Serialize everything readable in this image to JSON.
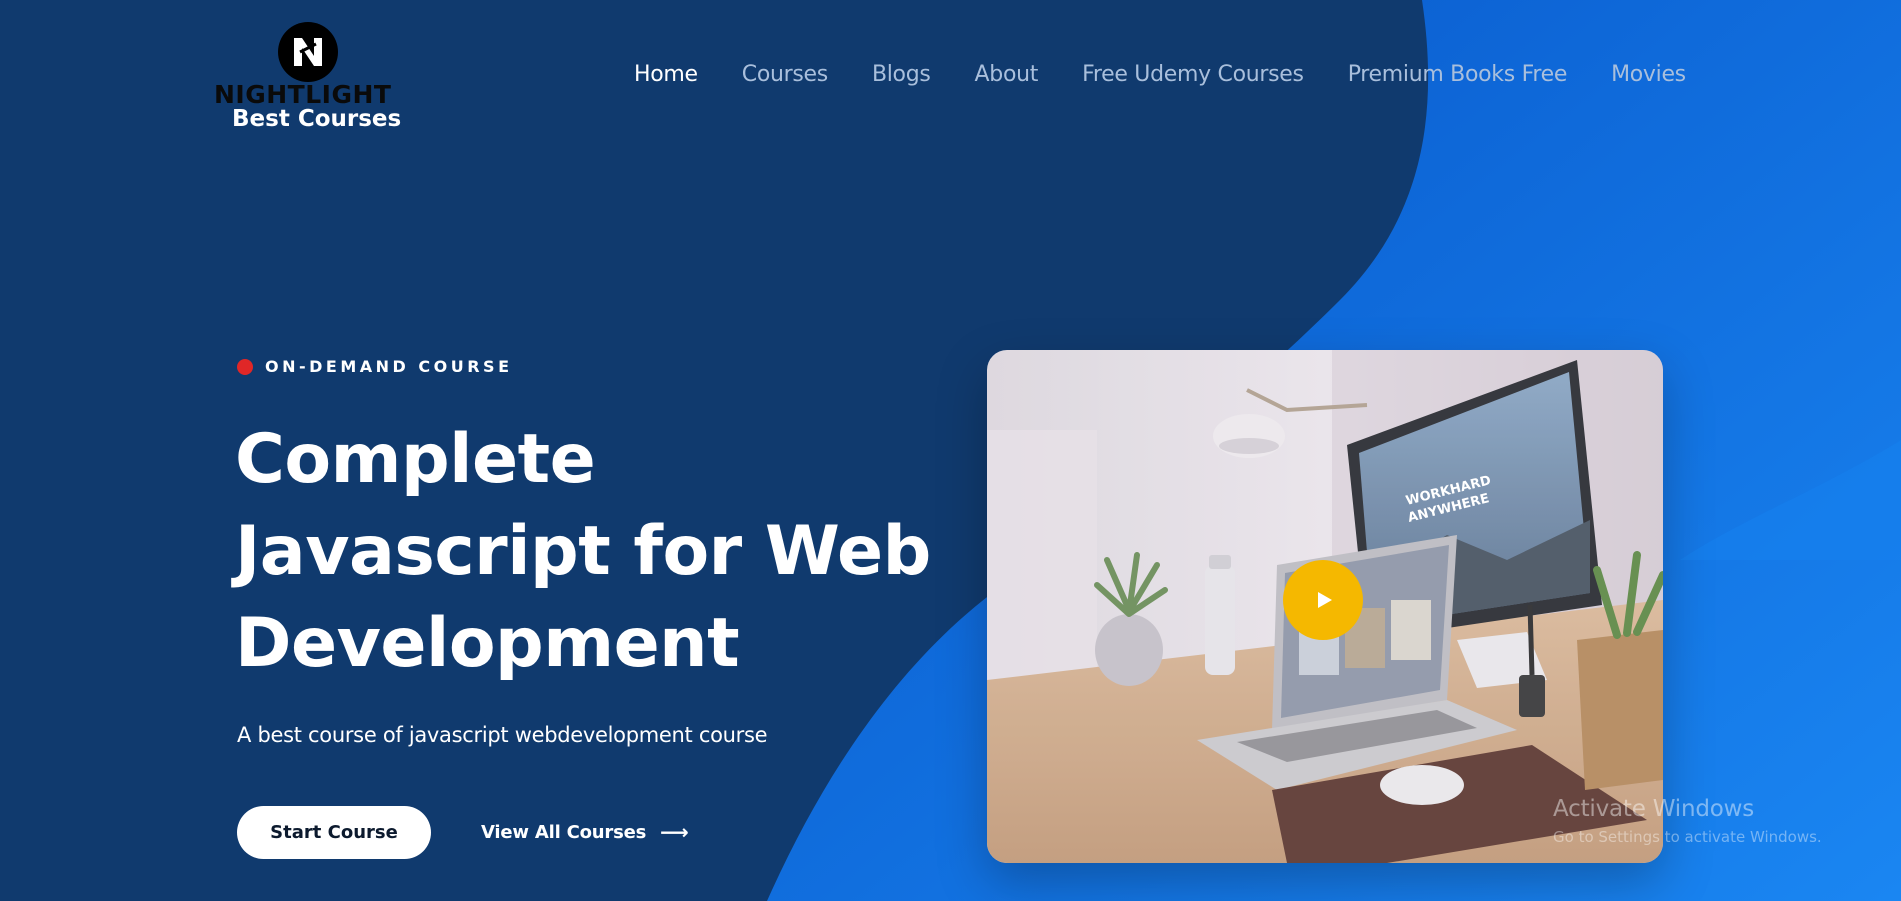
{
  "brand": {
    "wordmark": "NIGHTLIGHT",
    "tagline": "Best Courses"
  },
  "nav": {
    "items": [
      {
        "label": "Home",
        "active": true
      },
      {
        "label": "Courses"
      },
      {
        "label": "Blogs"
      },
      {
        "label": "About"
      },
      {
        "label": "Free Udemy Courses"
      },
      {
        "label": "Premium Books Free"
      },
      {
        "label": "Movies"
      }
    ]
  },
  "hero": {
    "eyebrow": "ON-DEMAND COURSE",
    "title": "Complete Javascript for Web Development",
    "subtitle": "A best course of javascript webdevelopment course",
    "primary_button": "Start Course",
    "secondary_link": "View All Courses",
    "secondary_link_icon": "arrow-right-icon"
  },
  "media": {
    "screen_text_line1": "WORKHARD",
    "screen_text_line2": "ANYWHERE",
    "play_icon": "play-icon"
  },
  "watermark": {
    "title": "Activate Windows",
    "subtitle": "Go to Settings to activate Windows."
  },
  "colors": {
    "background_dark": "#103a6e",
    "background_blue": "#0b67db",
    "accent_red": "#e02727",
    "accent_yellow": "#f5b800",
    "text_white": "#ffffff",
    "nav_muted": "#a9bfdc"
  }
}
